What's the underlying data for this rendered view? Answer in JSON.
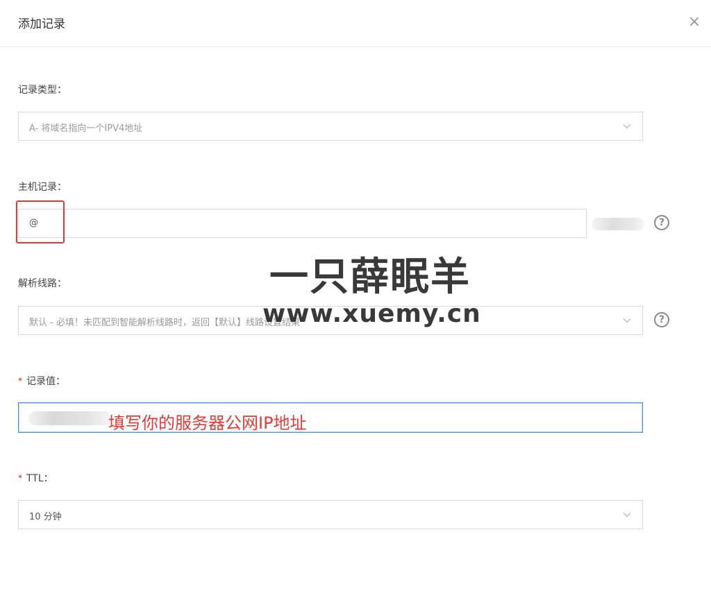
{
  "dialog": {
    "title": "添加记录",
    "close_label": "×"
  },
  "record_type": {
    "label": "记录类型：",
    "value": "A- 将域名指向一个IPV4地址"
  },
  "host_record": {
    "label": "主机记录：",
    "value": "@"
  },
  "line": {
    "label": "解析线路：",
    "value": "默认 - 必填！未匹配到智能解析线路时，返回【默认】线路设置结果"
  },
  "record_value": {
    "required_mark": "*",
    "label": "记录值：",
    "annotation": "填写你的服务器公网IP地址"
  },
  "ttl": {
    "required_mark": "*",
    "label": "TTL：",
    "value": "10 分钟"
  },
  "help_icon_text": "?",
  "watermark": {
    "line1": "一只薛眠羊",
    "line2": "www.xuemy.cn"
  },
  "colors": {
    "accent_border": "#4a90e2",
    "annotation_red": "#e53935",
    "required_red": "#e02020"
  }
}
